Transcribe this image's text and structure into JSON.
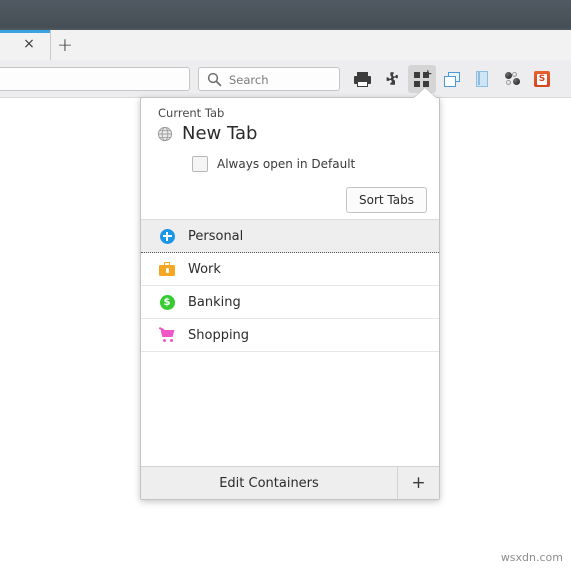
{
  "window": {
    "titlebar_color": "#4b535b"
  },
  "tabbar": {
    "close_label": "×",
    "new_tab_label": "+",
    "active_tab_accent": "#3ba4e0"
  },
  "navbar": {
    "url_value": "",
    "url_placeholder": "",
    "search": {
      "icon": "search-icon",
      "value": "",
      "placeholder": "Search"
    },
    "buttons": [
      {
        "name": "print-button",
        "icon": "printer-icon",
        "label": "Print",
        "active": false
      },
      {
        "name": "extensions-button",
        "icon": "puzzle-icon",
        "label": "Extensions",
        "active": false
      },
      {
        "name": "containers-button",
        "icon": "containers-icon",
        "label": "Containers",
        "active": true
      },
      {
        "name": "tab-groups-button",
        "icon": "windows-icon",
        "label": "Tab Groups",
        "active": false
      },
      {
        "name": "reader-button",
        "icon": "book-icon",
        "label": "Reader",
        "active": false
      },
      {
        "name": "molecule-button",
        "icon": "molecule-icon",
        "label": "Molecule",
        "active": false
      },
      {
        "name": "sapp-button",
        "icon": "s-app-icon",
        "label": "S",
        "active": false
      }
    ]
  },
  "panel": {
    "current_tab_label": "Current Tab",
    "current_tab_title": "New Tab",
    "current_tab_icon": "globe-icon",
    "always_open_checkbox": {
      "label": "Always open in Default",
      "checked": false
    },
    "sort_tabs_label": "Sort Tabs",
    "containers": [
      {
        "label": "Personal",
        "icon": "fence-plus-icon",
        "color": "#1b96e8",
        "selected": true
      },
      {
        "label": "Work",
        "icon": "briefcase-icon",
        "color": "#f5a623",
        "selected": false
      },
      {
        "label": "Banking",
        "icon": "dollar-icon",
        "color": "#34cc30",
        "selected": false,
        "glyph": "$"
      },
      {
        "label": "Shopping",
        "icon": "cart-icon",
        "color": "#f056c8",
        "selected": false
      }
    ],
    "footer": {
      "edit_label": "Edit Containers",
      "add_label": "+"
    }
  },
  "watermark": "wsxdn.com"
}
